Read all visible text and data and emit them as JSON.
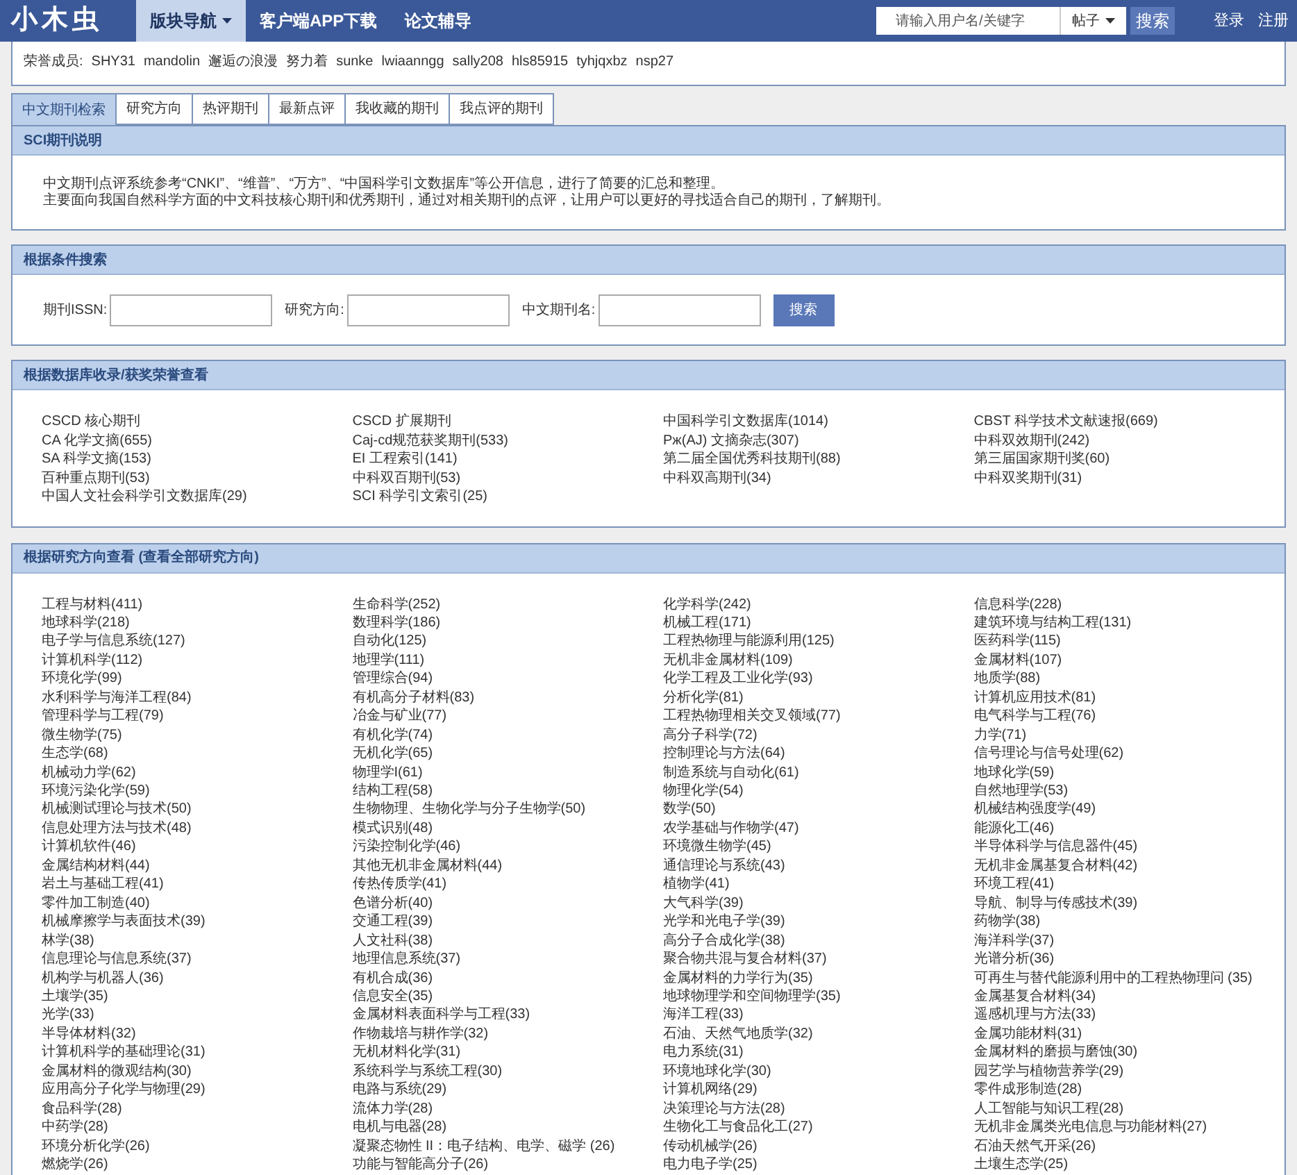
{
  "nav": {
    "logo": "小木虫",
    "items": [
      {
        "label": "版块导航",
        "selected": true,
        "dropdown": true
      },
      {
        "label": "客户端APP下载",
        "selected": false,
        "dropdown": false
      },
      {
        "label": "论文辅导",
        "selected": false,
        "dropdown": false
      }
    ],
    "search": {
      "placeholder": "请输入用户名/关键字",
      "scope": "帖子",
      "button": "搜索"
    },
    "auth": [
      "登录",
      "注册"
    ]
  },
  "honor": {
    "label": "荣誉成员:",
    "members": [
      "SHY31",
      "mandolin",
      "邂逅の浪漫",
      "努力着",
      "sunke",
      "lwiaanngg",
      "sally208",
      "hls85915",
      "tyhjqxbz",
      "nsp27"
    ]
  },
  "tabs": [
    {
      "label": "中文期刊检索",
      "selected": true
    },
    {
      "label": "研究方向",
      "selected": false
    },
    {
      "label": "热评期刊",
      "selected": false
    },
    {
      "label": "最新点评",
      "selected": false
    },
    {
      "label": "我收藏的期刊",
      "selected": false
    },
    {
      "label": "我点评的期刊",
      "selected": false
    }
  ],
  "sci_intro": {
    "title": "SCI期刊说明",
    "lines": [
      "中文期刊点评系统参考“CNKI”、“维普”、“万方”、“中国科学引文数据库”等公开信息，进行了简要的汇总和整理。",
      "主要面向我国自然科学方面的中文科技核心期刊和优秀期刊，通过对相关期刊的点评，让用户可以更好的寻找适合自己的期刊，了解期刊。"
    ]
  },
  "search_panel": {
    "title": "根据条件搜索",
    "fields": [
      {
        "label": "期刊ISSN:"
      },
      {
        "label": "研究方向:"
      },
      {
        "label": "中文期刊名:"
      }
    ],
    "button": "搜索"
  },
  "databases": {
    "title": "根据数据库收录/获奖荣誉查看",
    "items": [
      "CSCD 核心期刊",
      "CSCD 扩展期刊",
      "中国科学引文数据库(1014)",
      "CBST 科学技术文献速报(669)",
      "CA 化学文摘(655)",
      "Caj-cd规范获奖期刊(533)",
      "Pж(AJ) 文摘杂志(307)",
      "中科双效期刊(242)",
      "SA 科学文摘(153)",
      "EI 工程索引(141)",
      "第二届全国优秀科技期刊(88)",
      "第三届国家期刊奖(60)",
      "百种重点期刊(53)",
      "中科双百期刊(53)",
      "中科双高期刊(34)",
      "中科双奖期刊(31)",
      "中国人文社会科学引文数据库(29)",
      "SCI 科学引文索引(25)"
    ]
  },
  "research": {
    "title": "根据研究方向查看 (查看全部研究方向)",
    "items": [
      "工程与材料(411)",
      "生命科学(252)",
      "化学科学(242)",
      "信息科学(228)",
      "地球科学(218)",
      "数理科学(186)",
      "机械工程(171)",
      "建筑环境与结构工程(131)",
      "电子学与信息系统(127)",
      "自动化(125)",
      "工程热物理与能源利用(125)",
      "医药科学(115)",
      "计算机科学(112)",
      "地理学(111)",
      "无机非金属材料(109)",
      "金属材料(107)",
      "环境化学(99)",
      "管理综合(94)",
      "化学工程及工业化学(93)",
      "地质学(88)",
      "水利科学与海洋工程(84)",
      "有机高分子材料(83)",
      "分析化学(81)",
      "计算机应用技术(81)",
      "管理科学与工程(79)",
      "冶金与矿业(77)",
      "工程热物理相关交叉领域(77)",
      "电气科学与工程(76)",
      "微生物学(75)",
      "有机化学(74)",
      "高分子科学(72)",
      "力学(71)",
      "生态学(68)",
      "无机化学(65)",
      "控制理论与方法(64)",
      "信号理论与信号处理(62)",
      "机械动力学(62)",
      "物理学I(61)",
      "制造系统与自动化(61)",
      "地球化学(59)",
      "环境污染化学(59)",
      "结构工程(58)",
      "物理化学(54)",
      "自然地理学(53)",
      "机械测试理论与技术(50)",
      "生物物理、生物化学与分子生物学(50)",
      "数学(50)",
      "机械结构强度学(49)",
      "信息处理方法与技术(48)",
      "模式识别(48)",
      "农学基础与作物学(47)",
      "能源化工(46)",
      "计算机软件(46)",
      "污染控制化学(46)",
      "环境微生物学(45)",
      "半导体科学与信息器件(45)",
      "金属结构材料(44)",
      "其他无机非金属材料(44)",
      "通信理论与系统(43)",
      "无机非金属基复合材料(42)",
      "岩土与基础工程(41)",
      "传热传质学(41)",
      "植物学(41)",
      "环境工程(41)",
      "零件加工制造(40)",
      "色谱分析(40)",
      "大气科学(39)",
      "导航、制导与传感技术(39)",
      "机械摩擦学与表面技术(39)",
      "交通工程(39)",
      "光学和光电子学(39)",
      "药物学(38)",
      "林学(38)",
      "人文社科(38)",
      "高分子合成化学(38)",
      "海洋科学(37)",
      "信息理论与信息系统(37)",
      "地理信息系统(37)",
      "聚合物共混与复合材料(37)",
      "光谱分析(36)",
      "机构学与机器人(36)",
      "有机合成(36)",
      "金属材料的力学行为(35)",
      "可再生与替代能源利用中的工程热物理问 (35)",
      "土壤学(35)",
      "信息安全(35)",
      "地球物理学和空间物理学(35)",
      "金属基复合材料(34)",
      "光学(33)",
      "金属材料表面科学与工程(33)",
      "海洋工程(33)",
      "遥感机理与方法(33)",
      "半导体材料(32)",
      "作物栽培与耕作学(32)",
      "石油、天然气地质学(32)",
      "金属功能材料(31)",
      "计算机科学的基础理论(31)",
      "无机材料化学(31)",
      "电力系统(31)",
      "金属材料的磨损与磨蚀(30)",
      "金属材料的微观结构(30)",
      "系统科学与系统工程(30)",
      "环境地球化学(30)",
      "园艺学与植物营养学(29)",
      "应用高分子化学与物理(29)",
      "电路与系统(29)",
      "计算机网络(29)",
      "零件成形制造(28)",
      "食品科学(28)",
      "流体力学(28)",
      "决策理论与方法(28)",
      "人工智能与知识工程(28)",
      "中药学(28)",
      "电机与电器(28)",
      "生物化工与食品化工(27)",
      "无机非金属类光电信息与功能材料(27)",
      "环境分析化学(26)",
      "凝聚态物性 II：电子结构、电学、磁学 (26)",
      "传动机械学(26)",
      "石油天然气开采(26)",
      "燃烧学(26)",
      "功能与智能高分子(26)",
      "电力电子学(25)",
      "土壤生态学(25)"
    ]
  }
}
